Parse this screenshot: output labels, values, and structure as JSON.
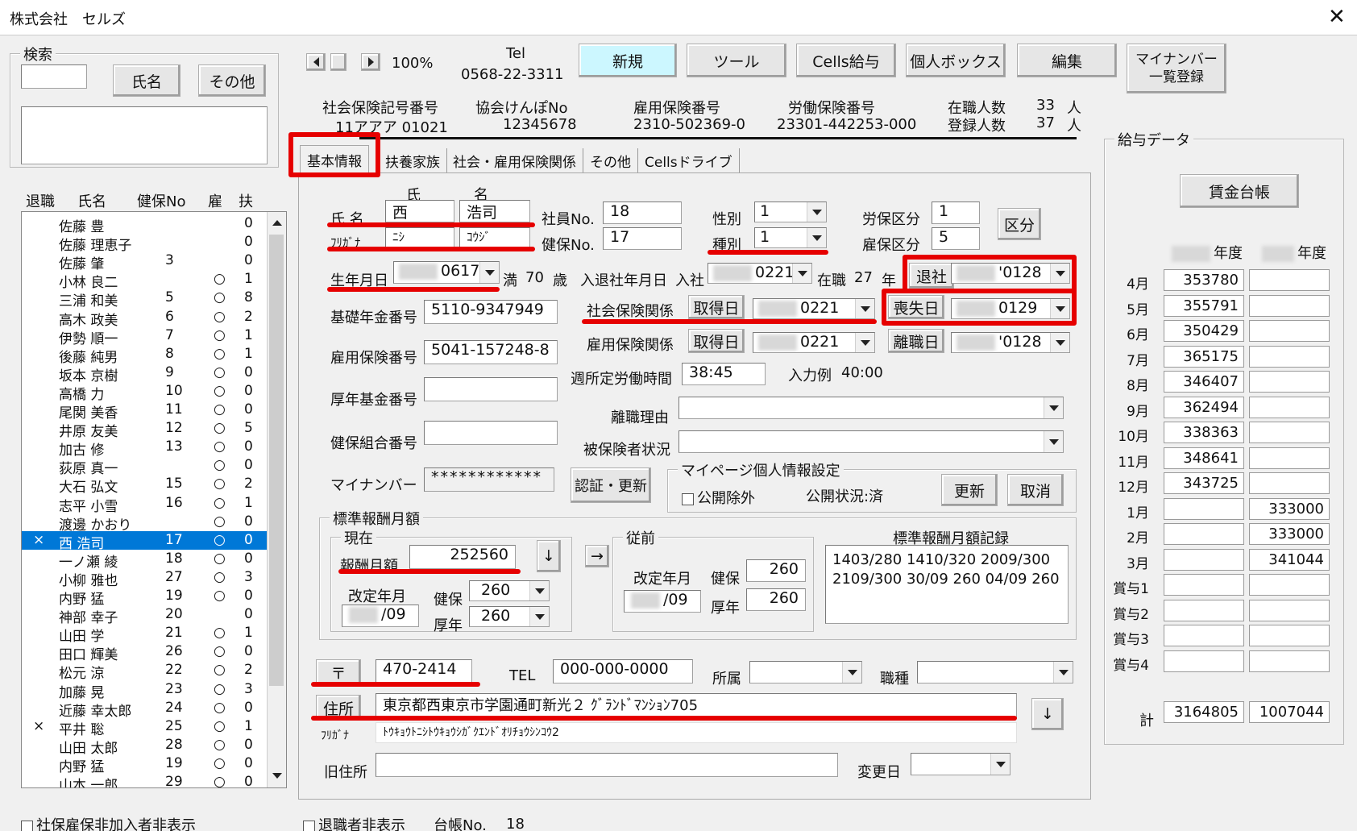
{
  "window": {
    "title": "株式会社　セルズ"
  },
  "search": {
    "legend": "検索",
    "name_btn": "氏名",
    "other_btn": "その他"
  },
  "list": {
    "headers": {
      "retired": "退職",
      "name": "氏名",
      "hi_no": "健保No",
      "emp": "雇",
      "dep": "扶"
    },
    "rows": [
      {
        "mark": "",
        "name": "佐藤 豊",
        "no": "",
        "emp": "",
        "dep": "0"
      },
      {
        "mark": "",
        "name": "佐藤 理恵子",
        "no": "",
        "emp": "",
        "dep": "0"
      },
      {
        "mark": "",
        "name": "佐藤 肇",
        "no": "3",
        "emp": "",
        "dep": "0"
      },
      {
        "mark": "",
        "name": "小林 良二",
        "no": "",
        "emp": "○",
        "dep": "1"
      },
      {
        "mark": "",
        "name": "三浦 和美",
        "no": "5",
        "emp": "○",
        "dep": "8"
      },
      {
        "mark": "",
        "name": "高木 政美",
        "no": "6",
        "emp": "○",
        "dep": "2"
      },
      {
        "mark": "",
        "name": "伊勢 順一",
        "no": "7",
        "emp": "○",
        "dep": "1"
      },
      {
        "mark": "",
        "name": "後藤 純男",
        "no": "8",
        "emp": "○",
        "dep": "1"
      },
      {
        "mark": "",
        "name": "坂本 京樹",
        "no": "9",
        "emp": "○",
        "dep": "0"
      },
      {
        "mark": "",
        "name": "高橋 力",
        "no": "10",
        "emp": "○",
        "dep": "0"
      },
      {
        "mark": "",
        "name": "尾関 美香",
        "no": "11",
        "emp": "○",
        "dep": "0"
      },
      {
        "mark": "",
        "name": "井原 友美",
        "no": "12",
        "emp": "○",
        "dep": "5"
      },
      {
        "mark": "",
        "name": "加古 修",
        "no": "13",
        "emp": "○",
        "dep": "0"
      },
      {
        "mark": "",
        "name": "荻原 真一",
        "no": "",
        "emp": "○",
        "dep": "0"
      },
      {
        "mark": "",
        "name": "大石 弘文",
        "no": "15",
        "emp": "○",
        "dep": "2"
      },
      {
        "mark": "",
        "name": "志平 小雪",
        "no": "16",
        "emp": "○",
        "dep": "1"
      },
      {
        "mark": "",
        "name": "渡邊 かおり",
        "no": "",
        "emp": "○",
        "dep": "0"
      },
      {
        "mark": "×",
        "name": "西 浩司",
        "no": "17",
        "emp": "○",
        "dep": "0"
      },
      {
        "mark": "",
        "name": "一ノ瀬 綾",
        "no": "18",
        "emp": "○",
        "dep": "0"
      },
      {
        "mark": "",
        "name": "小柳 雅也",
        "no": "27",
        "emp": "○",
        "dep": "3"
      },
      {
        "mark": "",
        "name": "内野 猛",
        "no": "19",
        "emp": "○",
        "dep": "0"
      },
      {
        "mark": "",
        "name": "神部 幸子",
        "no": "20",
        "emp": "",
        "dep": "0"
      },
      {
        "mark": "",
        "name": "山田 学",
        "no": "21",
        "emp": "○",
        "dep": "1"
      },
      {
        "mark": "",
        "name": "田口 輝美",
        "no": "26",
        "emp": "○",
        "dep": "0"
      },
      {
        "mark": "",
        "name": "松元 涼",
        "no": "22",
        "emp": "○",
        "dep": "2"
      },
      {
        "mark": "",
        "name": "加藤 晃",
        "no": "23",
        "emp": "○",
        "dep": "3"
      },
      {
        "mark": "",
        "name": "近藤 幸太郎",
        "no": "24",
        "emp": "○",
        "dep": "0"
      },
      {
        "mark": "×",
        "name": "平井 聡",
        "no": "25",
        "emp": "○",
        "dep": "1"
      },
      {
        "mark": "",
        "name": "山田 太郎",
        "no": "28",
        "emp": "○",
        "dep": "0"
      },
      {
        "mark": "",
        "name": "内野 猛",
        "no": "19",
        "emp": "○",
        "dep": "0"
      },
      {
        "mark": "",
        "name": "山本 一郎",
        "no": "29",
        "emp": "○",
        "dep": "0"
      }
    ],
    "selected_index": 17
  },
  "bottom": {
    "cb1": "社保雇保非加入者非表示",
    "cb2": "退職者非表示",
    "ledger_label": "台帳No.",
    "ledger_no": "18"
  },
  "toolbar": {
    "zoom": "100%",
    "tel_label": "Tel",
    "tel": "0568-22-3311",
    "new": "新規",
    "tool": "ツール",
    "cells_pay": "Cells給与",
    "personal_box": "個人ボックス",
    "edit": "編集",
    "mynumber_l1": "マイナンバー",
    "mynumber_l2": "一覧登録"
  },
  "company": {
    "si_label": "社会保険記号番号",
    "si_value": "11アアア 01021",
    "kyokai_label": "協会けんぽNo",
    "kyokai_value": "12345678",
    "emp_ins_label": "雇用保険番号",
    "emp_ins_value": "2310-502369-0",
    "labor_label": "労働保険番号",
    "labor_value": "23301-442253-000",
    "enrolled_label": "在職人数",
    "enrolled_value": "33",
    "registered_label": "登録人数",
    "registered_value": "37",
    "unit": "人"
  },
  "tabs": [
    "基本情報",
    "扶養家族",
    "社会・雇用保険関係",
    "その他",
    "Cellsドライブ"
  ],
  "form": {
    "sei": "氏",
    "mei": "名",
    "name_label": "氏 名",
    "furi_label": "ﾌﾘｶﾞﾅ",
    "last": "西",
    "first": "浩司",
    "last_kana": "ﾆｼ",
    "first_kana": "ｺｳｼﾞ",
    "emp_no_label": "社員No.",
    "emp_no": "18",
    "hi_no_label": "健保No.",
    "hi_no": "17",
    "sex_label": "性別",
    "sex": "1",
    "kind_label": "種別",
    "kind": "1",
    "labor_cat_label": "労保区分",
    "labor_cat": "1",
    "emp_cat_label": "雇保区分",
    "emp_cat": "5",
    "cat_btn": "区分",
    "birth_label": "生年月日",
    "birth": "0617",
    "age_pre": "満",
    "age": "70",
    "age_unit": "歳",
    "join_label": "入退社年月日",
    "join_pre": "入社",
    "join": "0221",
    "tenure_pre": "在職",
    "tenure": "27",
    "tenure_unit": "年",
    "retire_label": "退社",
    "retire": "'0128",
    "pension_label": "基礎年金番号",
    "pension": "5110-9347949",
    "si_rel_label": "社会保険関係",
    "acquire_btn": "取得日",
    "si_acquire": "0221",
    "lose_btn": "喪失日",
    "si_lose": "0129",
    "ei_no_label": "雇用保険番号",
    "ei_no": "5041-157248-8",
    "ei_rel_label": "雇用保険関係",
    "ei_acquire": "0221",
    "leave_btn": "離職日",
    "ei_leave": "'0128",
    "weekly_label": "週所定労働時間",
    "weekly": "38:45",
    "example_label": "入力例",
    "example": "40:00",
    "kounen_label": "厚年基金番号",
    "sep_reason_label": "離職理由",
    "union_label": "健保組合番号",
    "insured_status_label": "被保険者状況",
    "mynumber_label": "マイナンバー",
    "mynumber": "************",
    "auth_btn": "認証・更新",
    "mypage_legend": "マイページ個人情報設定",
    "public_exclude": "公開除外",
    "public_status": "公開状況:済",
    "update_btn": "更新",
    "cancel_btn": "取消"
  },
  "std": {
    "legend": "標準報酬月額",
    "current": "現在",
    "pay_label": "報酬月額",
    "pay": "252560",
    "down": "↓",
    "right": "→",
    "revised_label": "改定年月",
    "revised": "/09",
    "kenpo_label": "健保",
    "kenpo": "260",
    "kounen_label": "厚年",
    "kounen": "260",
    "prev": "従前",
    "prev_revised": "/09",
    "prev_kenpo": "260",
    "prev_kounen": "260",
    "record_label": "標準報酬月額記録",
    "record_l1": "1403/280 1410/320  2009/300",
    "record_l2": "2109/300 30/09 260 04/09 260"
  },
  "address": {
    "zip_btn": "〒",
    "zip": "470-2414",
    "tel_label": "TEL",
    "tel": "000-000-0000",
    "dept_label": "所属",
    "job_label": "職種",
    "addr_btn": "住所",
    "addr": "東京都西東京市学園通町新光２ ｸﾞﾗﾝﾄﾞﾏﾝｼｮﾝ705",
    "furi_label": "ﾌﾘｶﾞﾅ",
    "furi": "ﾄｳｷｮｳﾄﾆｼﾄｳｷｮｳｼｶﾞｸｴﾝﾄﾞｵﾘﾁｮｳｼﾝｺｳ2",
    "down": "↓",
    "old_label": "旧住所",
    "change_label": "変更日"
  },
  "salary": {
    "legend": "給与データ",
    "ledger_btn": "賃金台帳",
    "year1": "年度",
    "year2": "年度",
    "rows": [
      {
        "m": "4月",
        "a": "353780",
        "b": ""
      },
      {
        "m": "5月",
        "a": "355791",
        "b": ""
      },
      {
        "m": "6月",
        "a": "350429",
        "b": ""
      },
      {
        "m": "7月",
        "a": "365175",
        "b": ""
      },
      {
        "m": "8月",
        "a": "346407",
        "b": ""
      },
      {
        "m": "9月",
        "a": "362494",
        "b": ""
      },
      {
        "m": "10月",
        "a": "338363",
        "b": ""
      },
      {
        "m": "11月",
        "a": "348641",
        "b": ""
      },
      {
        "m": "12月",
        "a": "343725",
        "b": ""
      },
      {
        "m": "1月",
        "a": "",
        "b": "333000"
      },
      {
        "m": "2月",
        "a": "",
        "b": "333000"
      },
      {
        "m": "3月",
        "a": "",
        "b": "341044"
      },
      {
        "m": "賞与1",
        "a": "",
        "b": ""
      },
      {
        "m": "賞与2",
        "a": "",
        "b": ""
      },
      {
        "m": "賞与3",
        "a": "",
        "b": ""
      },
      {
        "m": "賞与4",
        "a": "",
        "b": ""
      }
    ],
    "total_label": "計",
    "total_a": "3164805",
    "total_b": "1007044"
  }
}
